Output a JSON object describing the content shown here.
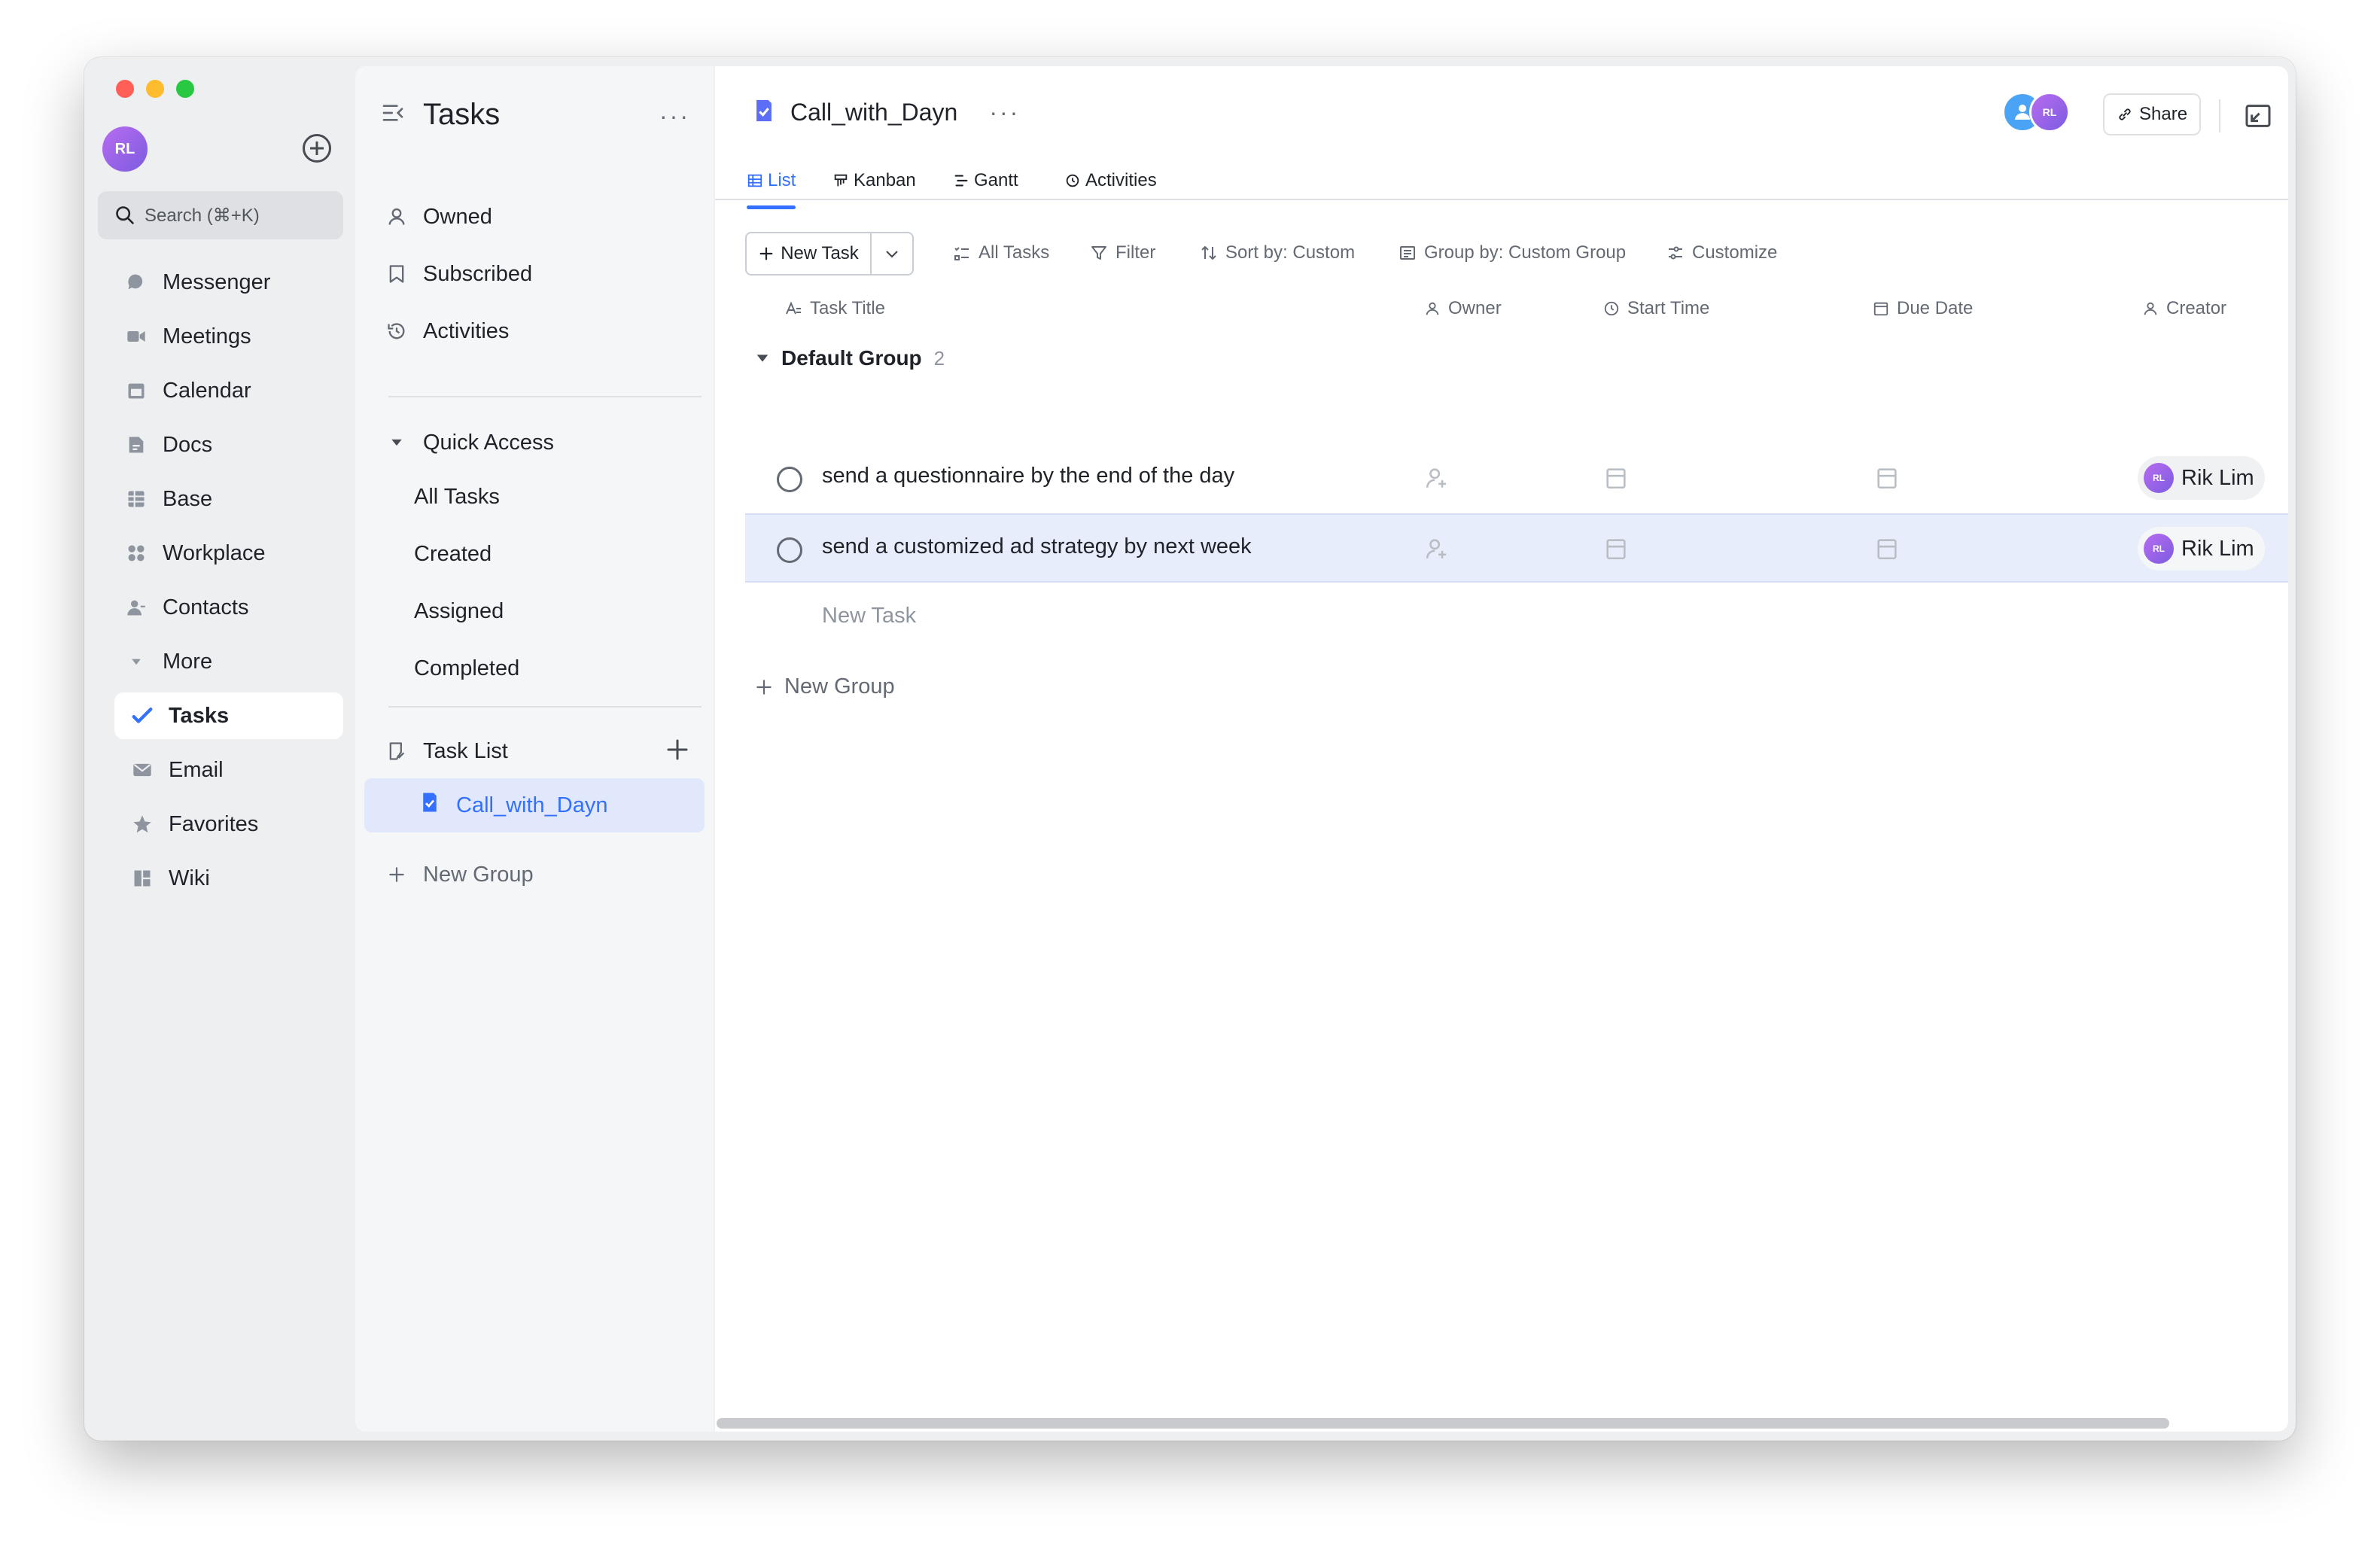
{
  "sidebar": {
    "avatar_initials": "RL",
    "search_placeholder": "Search (⌘+K)",
    "items": [
      {
        "label": "Messenger",
        "icon": "messenger-icon"
      },
      {
        "label": "Meetings",
        "icon": "video-camera-icon"
      },
      {
        "label": "Calendar",
        "icon": "calendar-icon"
      },
      {
        "label": "Docs",
        "icon": "docs-icon"
      },
      {
        "label": "Base",
        "icon": "base-icon"
      },
      {
        "label": "Workplace",
        "icon": "workplace-icon"
      },
      {
        "label": "Contacts",
        "icon": "contacts-icon"
      },
      {
        "label": "More",
        "icon": "chevron-down-icon"
      }
    ],
    "more_items": [
      {
        "label": "Tasks",
        "icon": "tasks-icon",
        "active": true
      },
      {
        "label": "Email",
        "icon": "email-icon"
      },
      {
        "label": "Favorites",
        "icon": "star-icon"
      },
      {
        "label": "Wiki",
        "icon": "wiki-icon"
      }
    ]
  },
  "tasks_panel": {
    "title": "Tasks",
    "top_items": [
      "Owned",
      "Subscribed",
      "Activities"
    ],
    "quick_access_label": "Quick Access",
    "quick_access_items": [
      "All Tasks",
      "Created",
      "Assigned",
      "Completed"
    ],
    "task_list_label": "Task List",
    "task_lists": [
      "Call_with_Dayn"
    ],
    "new_group_label": "New Group"
  },
  "main": {
    "title": "Call_with_Dayn",
    "share_label": "Share",
    "header_avatar_initials": "RL",
    "tabs": [
      "List",
      "Kanban",
      "Gantt",
      "Activities"
    ],
    "active_tab": "List",
    "toolbar": {
      "new_task": "New Task",
      "all_tasks": "All Tasks",
      "filter": "Filter",
      "sort": "Sort by: Custom",
      "group": "Group by: Custom Group",
      "customize": "Customize"
    },
    "columns": [
      "Task Title",
      "Owner",
      "Start Time",
      "Due Date",
      "Creator"
    ],
    "group": {
      "name": "Default Group",
      "count": "2"
    },
    "tasks": [
      {
        "title": "send a questionnaire by the end of the day",
        "creator": "Rik Lim",
        "creator_initials": "RL"
      },
      {
        "title": "send a customized ad strategy by next week",
        "creator": "Rik Lim",
        "creator_initials": "RL"
      }
    ],
    "new_task_placeholder": "New Task",
    "new_group_label": "New Group"
  },
  "colors": {
    "accent": "#3370ff",
    "highlight_row": "#e8edfc",
    "avatar": "#9b6cf0"
  }
}
